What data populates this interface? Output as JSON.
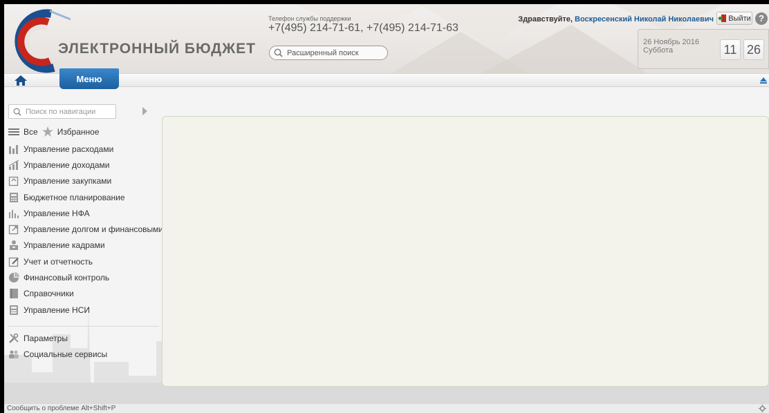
{
  "header": {
    "logo_text": "ЭЛЕКТРОННЫЙ БЮДЖЕТ",
    "support_label": "Телефон службы поддержки",
    "support_phone": "+7(495) 214-71-61, +7(495) 214-71-63",
    "search_label": "Расширенный поиск",
    "greeting_prefix": "Здравствуйте,",
    "user_name": "Воскресенский Николай Николаевич",
    "logout_label": "Выйти",
    "help_label": "?",
    "date": "26 Ноябрь 2016",
    "weekday": "Суббота",
    "time_hours": "11",
    "time_minutes": "26"
  },
  "navbar": {
    "menu_label": "Меню"
  },
  "sidebar": {
    "search_placeholder": "Поиск по навигации",
    "all_label": "Все",
    "favorites_label": "Избранное",
    "items": [
      {
        "label": "Управление расходами",
        "icon": "expenses-icon"
      },
      {
        "label": "Управление доходами",
        "icon": "income-icon"
      },
      {
        "label": "Управление закупками",
        "icon": "purchases-icon"
      },
      {
        "label": "Бюджетное планирование",
        "icon": "calculator-icon"
      },
      {
        "label": "Управление НФА",
        "icon": "bar-chart-icon"
      },
      {
        "label": "Управление долгом и финансовыми",
        "icon": "debt-icon"
      },
      {
        "label": "Управление кадрами",
        "icon": "personnel-icon"
      },
      {
        "label": "Учет и отчетность",
        "icon": "edit-report-icon"
      },
      {
        "label": "Финансовый контроль",
        "icon": "pie-chart-icon"
      },
      {
        "label": "Справочники",
        "icon": "book-icon"
      },
      {
        "label": "Управление НСИ",
        "icon": "nsi-icon"
      }
    ],
    "params_label": "Параметры",
    "social_label": "Социальные сервисы"
  },
  "footer": {
    "report_label": "Сообщить о проблеме Alt+Shift+P"
  },
  "colors": {
    "accent": "#1f5c96",
    "menu_tab": "#2a74b8",
    "logo_red": "#c8261d",
    "logo_blue": "#1c4f8f"
  }
}
